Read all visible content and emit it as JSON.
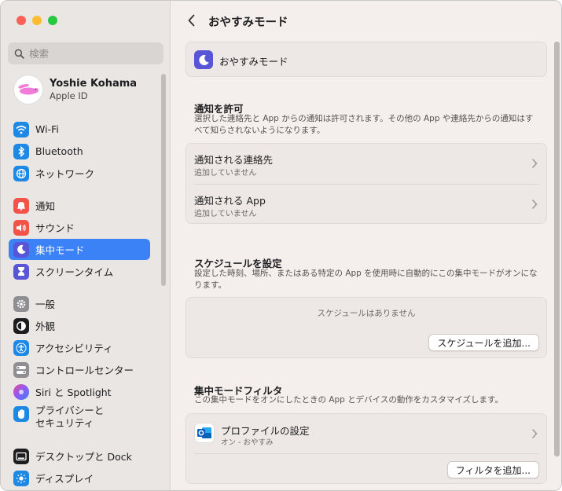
{
  "sidebar": {
    "search_placeholder": "検索",
    "account": {
      "name": "Yoshie Kohama",
      "sub": "Apple ID"
    },
    "items": [
      {
        "label": "Wi-Fi",
        "icon": "wifi-icon",
        "color": "#1e88e5"
      },
      {
        "label": "Bluetooth",
        "icon": "bluetooth-icon",
        "color": "#1e88e5"
      },
      {
        "label": "ネットワーク",
        "icon": "globe-icon",
        "color": "#1e88e5"
      },
      {
        "label": "通知",
        "icon": "bell-icon",
        "color": "#f2544a"
      },
      {
        "label": "サウンド",
        "icon": "speaker-icon",
        "color": "#f2544a"
      },
      {
        "label": "集中モード",
        "icon": "moon-icon",
        "color": "#5856d6",
        "selected": true
      },
      {
        "label": "スクリーンタイム",
        "icon": "hourglass-icon",
        "color": "#5856d6"
      },
      {
        "label": "一般",
        "icon": "gear-icon",
        "color": "#8e8e93"
      },
      {
        "label": "外観",
        "icon": "appearance-icon",
        "color": "#1d1d1f"
      },
      {
        "label": "アクセシビリティ",
        "icon": "accessibility-icon",
        "color": "#1e88e5"
      },
      {
        "label": "コントロールセンター",
        "icon": "control-center-icon",
        "color": "#8e8e93"
      },
      {
        "label": "Siri と Spotlight",
        "icon": "siri-icon",
        "color": "#a855f7"
      },
      {
        "label": "プライバシーと\nセキュリティ",
        "icon": "hand-icon",
        "color": "#1e88e5"
      },
      {
        "label": "デスクトップと Dock",
        "icon": "desktop-icon",
        "color": "#1d1d1f"
      },
      {
        "label": "ディスプレイ",
        "icon": "display-icon",
        "color": "#1e88e5"
      }
    ]
  },
  "main": {
    "title": "おやすみモード",
    "mode_card": {
      "label": "おやすみモード",
      "icon": "moon-icon",
      "color": "#5856d6"
    },
    "allow": {
      "heading": "通知を許可",
      "desc": "選択した連絡先と App からの通知は許可されます。その他の App や連絡先からの通知はすべて知らされないようになります。",
      "rows": [
        {
          "title": "通知される連絡先",
          "sub": "追加していません"
        },
        {
          "title": "通知される App",
          "sub": "追加していません"
        }
      ]
    },
    "schedule": {
      "heading": "スケジュールを設定",
      "desc": "設定した時刻、場所、またはある特定の App を使用時に自動的にこの集中モードがオンになります。",
      "empty": "スケジュールはありません",
      "add_button": "スケジュールを追加..."
    },
    "filter": {
      "heading": "集中モードフィルタ",
      "desc": "この集中モードをオンにしたときの App とデバイスの動作をカスタマイズします。",
      "profile_title": "プロファイルの設定",
      "profile_sub": "オン - おやすみ",
      "add_button": "フィルタを追加..."
    }
  }
}
